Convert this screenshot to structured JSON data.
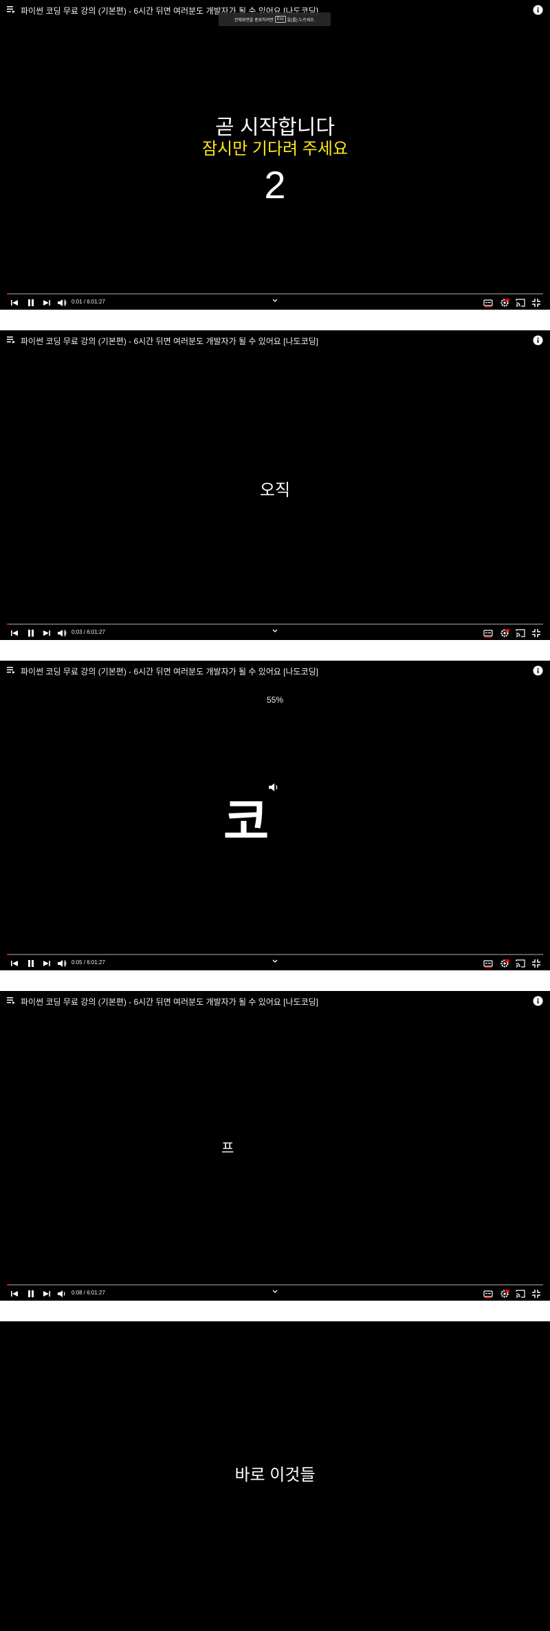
{
  "video": {
    "title": "파이썬 코딩 무료 강의 (기본편) - 6시간 뒤면 여러분도 개발자가 될 수 있어요 [나도코딩]",
    "duration": "6:01:27"
  },
  "toast": {
    "text_before": "전체화면을 종료하려면",
    "key": "Esc",
    "text_after": "을(를) 누르세요."
  },
  "icons": {
    "playlist": "playlist-icon",
    "info": "info-icon",
    "prev": "skip-previous-icon",
    "pause": "pause-icon",
    "next": "skip-next-icon",
    "volume": "volume-icon",
    "chevron": "chevron-down-icon",
    "subtitles": "subtitles-icon",
    "settings": "settings-icon",
    "cast": "cast-icon",
    "fullscreen_exit": "fullscreen-exit-icon"
  },
  "colors": {
    "progress_played": "#ff0000",
    "subtitle_yellow": "#ffe81a",
    "hd_badge": "#ff0000"
  },
  "frames": [
    {
      "time_current": "0:01",
      "time_label": "0:01 / 6:01:27",
      "progress_fraction": 0.0005,
      "caption_line1": "곧 시작합니다",
      "caption_line2": "잠시만 기다려 주세요",
      "countdown": "2"
    },
    {
      "time_current": "0:03",
      "time_label": "0:03 / 6:01:27",
      "progress_fraction": 0.0014,
      "caption": "오직"
    },
    {
      "time_current": "0:05",
      "time_label": "0:05 / 6:01:27",
      "progress_fraction": 0.0023,
      "volume_overlay": "55%",
      "caption": "코"
    },
    {
      "time_current": "0:08",
      "time_label": "0:08 / 6:01:27",
      "progress_fraction": 0.0037,
      "caption": "프"
    },
    {
      "caption": "바로 이것들"
    }
  ]
}
